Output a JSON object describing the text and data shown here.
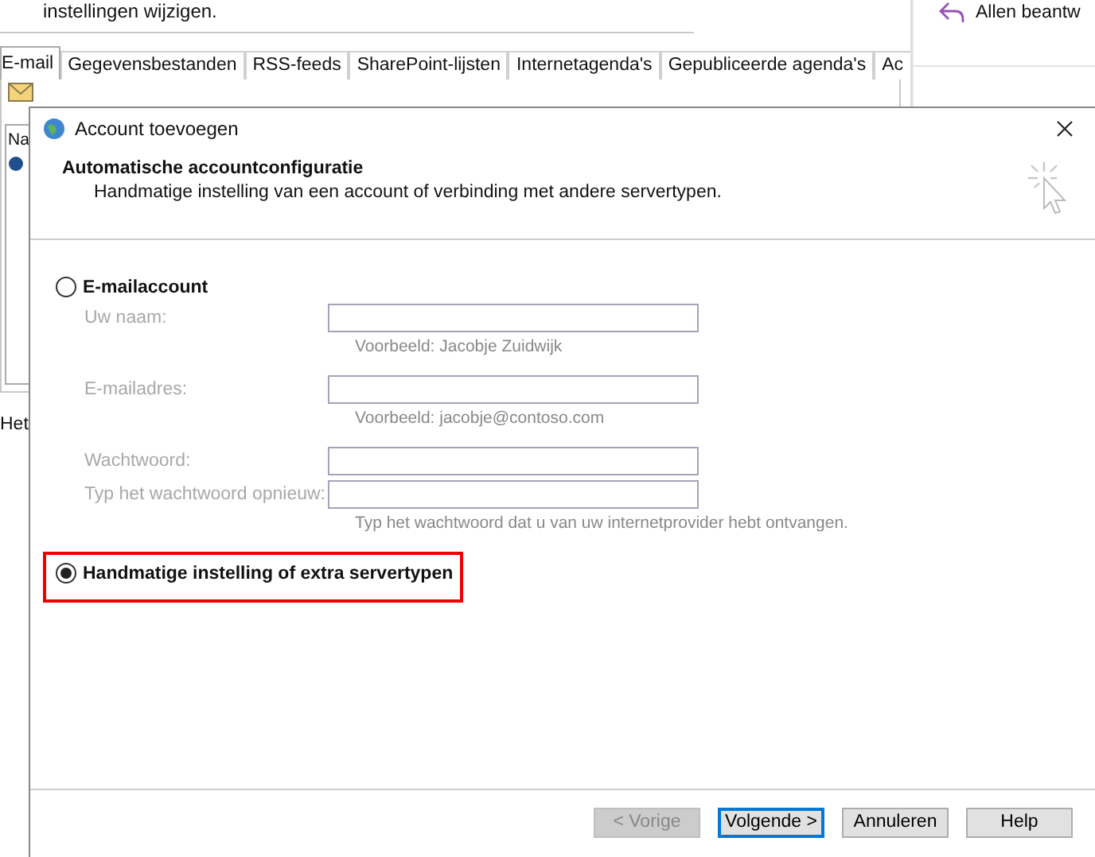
{
  "background": {
    "header_text": "instellingen wijzigen.",
    "reply_all": "Allen beantw",
    "tabs": [
      {
        "label": "E-mail",
        "selected": true
      },
      {
        "label": "Gegevensbestanden",
        "selected": false
      },
      {
        "label": "RSS-feeds",
        "selected": false
      },
      {
        "label": "SharePoint-lijsten",
        "selected": false
      },
      {
        "label": "Internetagenda's",
        "selected": false
      },
      {
        "label": "Gepubliceerde agenda's",
        "selected": false
      },
      {
        "label": "Ac",
        "selected": false
      }
    ],
    "list_header": "Na",
    "footer_text": "Het"
  },
  "dialog": {
    "title": "Account toevoegen",
    "heading": "Automatische accountconfiguratie",
    "subheading": "Handmatige instelling van een account of verbinding met andere servertypen.",
    "options": [
      {
        "kind": "form",
        "label": "E-mailaccount",
        "selected": false,
        "highlighted": false,
        "fields": [
          {
            "label": "Uw naam:",
            "hint": "Voorbeeld: Jacobje Zuidwijk",
            "disabled": true
          },
          {
            "label": "E-mailadres:",
            "hint": "Voorbeeld: jacobje@contoso.com",
            "disabled": true
          },
          {
            "label": "Wachtwoord:",
            "disabled": true
          },
          {
            "label": "Typ het wachtwoord opnieuw:",
            "hint": "Typ het wachtwoord dat u van uw internetprovider hebt ontvangen.",
            "disabled": true
          }
        ]
      },
      {
        "kind": "plain",
        "label": "Handmatige instelling of extra servertypen",
        "selected": true,
        "highlighted": true
      }
    ],
    "buttons": [
      {
        "label": "< Vorige",
        "disabled": true,
        "default": false
      },
      {
        "label": "Volgende >",
        "disabled": false,
        "default": true
      },
      {
        "label": "Annuleren",
        "disabled": false,
        "default": false
      },
      {
        "label": "Help",
        "disabled": false,
        "default": false
      }
    ]
  }
}
